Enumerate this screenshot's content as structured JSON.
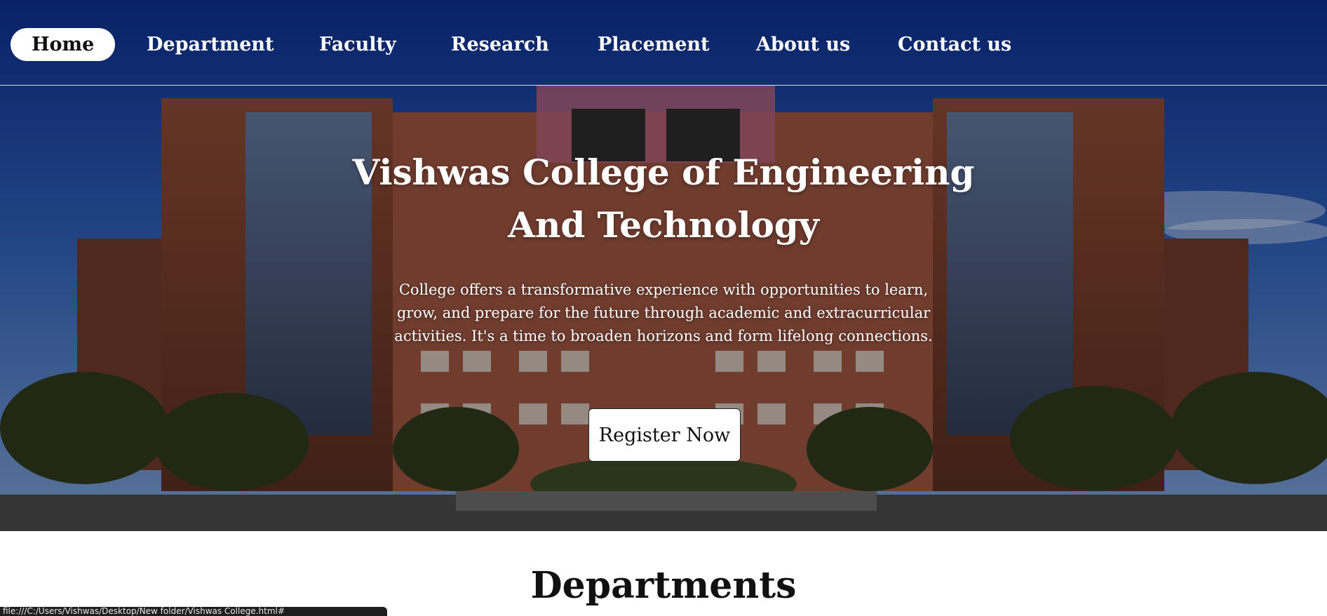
{
  "nav": {
    "items": [
      {
        "label": "Home",
        "active": true
      },
      {
        "label": "Department"
      },
      {
        "label": "Faculty"
      },
      {
        "label": "Research"
      },
      {
        "label": "Placement"
      },
      {
        "label": "About us"
      },
      {
        "label": "Contact us"
      }
    ]
  },
  "hero": {
    "title": "Vishwas College of Engineering And Technology",
    "description": "College offers a transformative experience with opportunities to learn, grow, and prepare for the future through academic and extracurricular activities. It's a time to broaden horizons and form lifelong connections.",
    "register_label": "Register Now"
  },
  "departments": {
    "title": "Departments"
  },
  "status": {
    "url": "file:///C:/Users/Vishwas/Desktop/New folder/Vishwas College.html#"
  },
  "colors": {
    "nav_text": "#ffffff",
    "active_pill_bg": "#ffffff",
    "active_pill_text": "#111111",
    "button_bg": "#ffffff",
    "heading_text": "#111111"
  }
}
